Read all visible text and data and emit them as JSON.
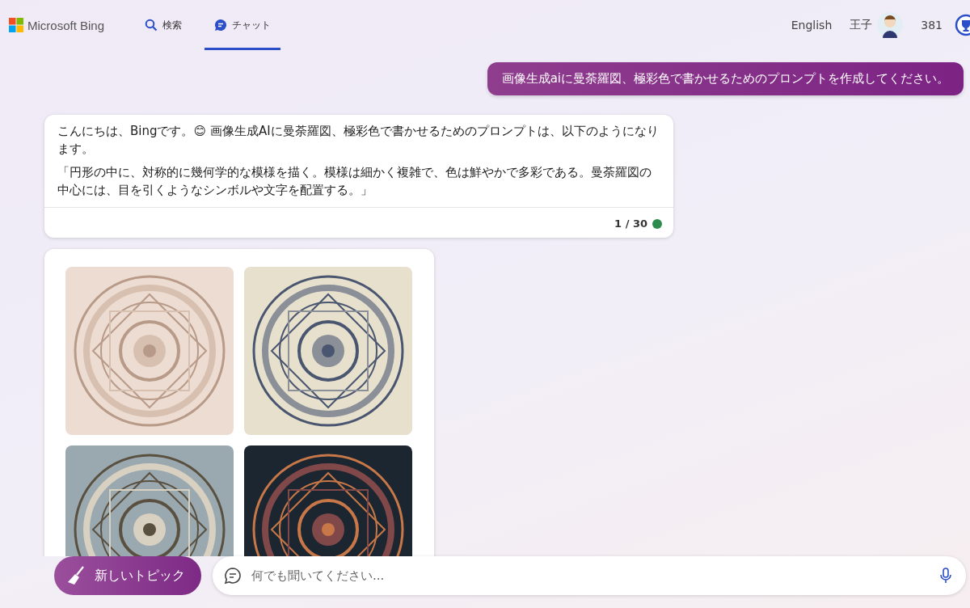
{
  "header": {
    "logo": "Microsoft Bing",
    "tabs": [
      {
        "label": "検索",
        "kind": "search",
        "selected": false
      },
      {
        "label": "チャット",
        "kind": "chat",
        "selected": true
      }
    ],
    "language": "English",
    "user_name": "王子",
    "points": "381"
  },
  "conversation": [
    {
      "kind": "user",
      "text": "画像生成aiに曼荼羅図、極彩色で書かせるためのプロンプトを作成してください。"
    },
    {
      "kind": "bot",
      "paragraphs": [
        "こんにちは、Bingです。😊 画像生成AIに曼荼羅図、極彩色で書かせるためのプロンプトは、以下のようになります。",
        "「円形の中に、対称的に幾何学的な模様を描く。模様は細かく複雑で、色は鮮やかで多彩である。曼荼羅図の中心には、目を引くようなシンボルや文字を配置する。」"
      ],
      "counter": "1 / 30"
    },
    {
      "kind": "images"
    }
  ],
  "composer": {
    "new_topic": "新しいトピック",
    "placeholder": "何でも聞いてください..."
  }
}
